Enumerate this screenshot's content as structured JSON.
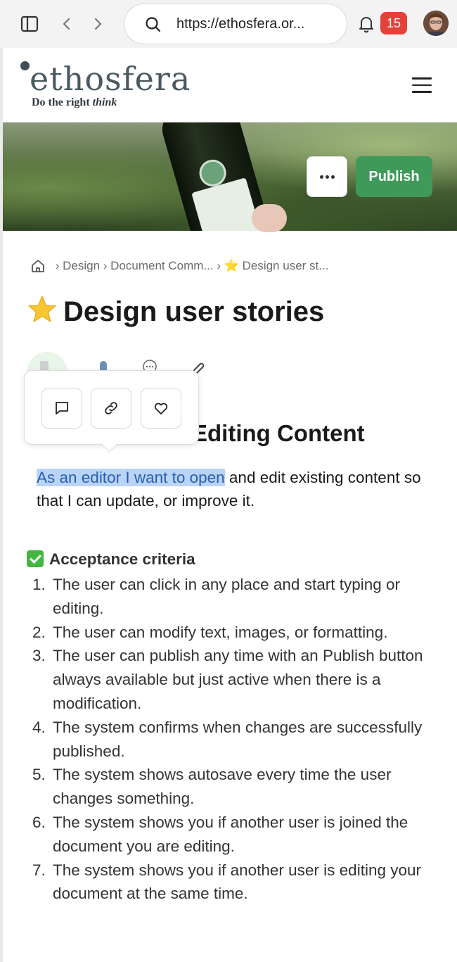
{
  "browser": {
    "url": "https://ethosfera.or...",
    "notification_count": "15",
    "icons": {
      "sidebar": "sidebar-icon",
      "back": "chevron-left-icon",
      "forward": "chevron-right-icon",
      "search": "search-icon",
      "bell": "bell-icon"
    }
  },
  "site": {
    "logo": "ethosfera",
    "tagline_plain": "Do the right ",
    "tagline_italic": "think"
  },
  "banner": {
    "more_label": "···",
    "publish_label": "Publish",
    "publish_color": "#3f9a5a"
  },
  "breadcrumb": {
    "items": [
      "Design",
      "Document Comm...",
      "⭐ Design user st..."
    ]
  },
  "page": {
    "title": "Design user stories",
    "section_visible": "rt Editing Content",
    "section_partial": "y",
    "story_highlight": "As an editor I want to open",
    "story_rest": " and edit existing content so that I can update, or improve it."
  },
  "popup": {
    "buttons": [
      "comment",
      "link",
      "like"
    ]
  },
  "acceptance": {
    "heading": "Acceptance criteria",
    "items": [
      {
        "num": "1.",
        "text": "The user can click in any place and start typing or editing."
      },
      {
        "num": "2.",
        "text": "The user can modify text, images, or formatting."
      },
      {
        "num": "3.",
        "text": "The user can publish any time with an Publish button always available but just active when there is a modification."
      },
      {
        "num": "4.",
        "text": "The system confirms when changes are successfully published."
      },
      {
        "num": "5.",
        "text": "The system shows autosave every time the user changes something."
      },
      {
        "num": "6.",
        "text": "The system shows you if another user is joined the document you are editing."
      },
      {
        "num": "7.",
        "text": "The system shows you if another user is editing your document at the same time."
      }
    ]
  }
}
